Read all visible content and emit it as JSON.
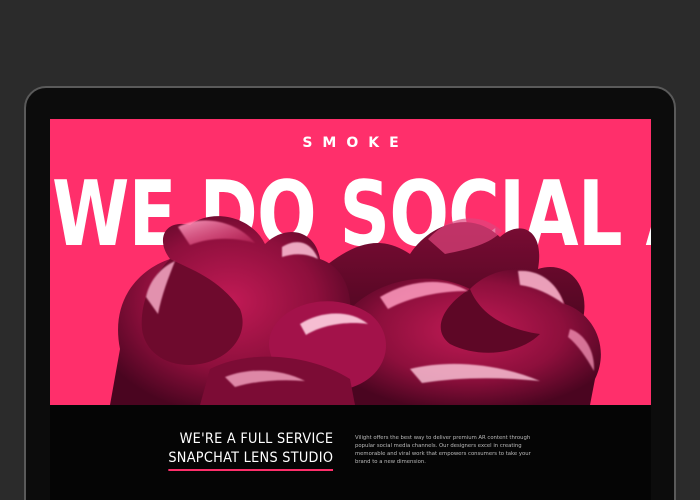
{
  "hero": {
    "logo": "SMOKE",
    "headline": "WE DO SOCIAL AR",
    "background_color": "#ff2f6b"
  },
  "info": {
    "tagline_line1": "WE'RE A FULL SERVICE",
    "tagline_line2": "SNAPCHAT LENS STUDIO",
    "description": "Vilight offers the best way to deliver premium AR content through popular social media channels. Our designers excel in creating memorable and viral work that empowers consumers to take your brand to a new dimension.",
    "accent_color": "#ff2f6b"
  }
}
